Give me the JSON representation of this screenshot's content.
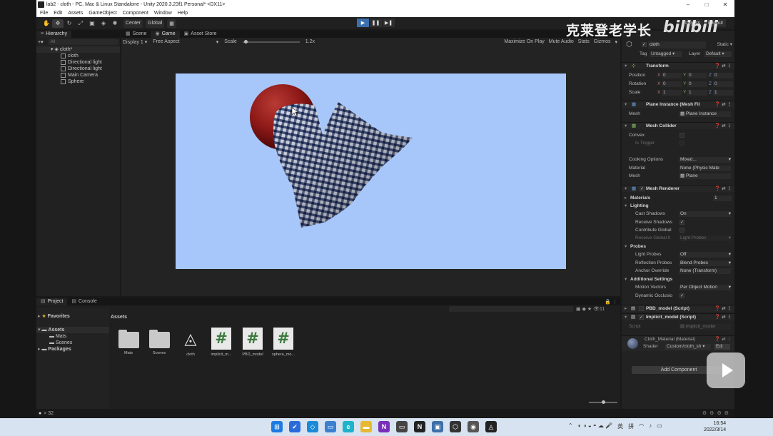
{
  "window": {
    "title": "lab2 - cloth - PC, Mac & Linux Standalone - Unity 2020.3.23f1 Personal* <DX11>",
    "controls": [
      "–",
      "□",
      "✕"
    ]
  },
  "menu": [
    "File",
    "Edit",
    "Assets",
    "GameObject",
    "Component",
    "Window",
    "Help"
  ],
  "toolbar": {
    "pivot": "Center",
    "space": "Global",
    "layers": "Layers",
    "layout": "Layout"
  },
  "watermark": {
    "text": "克莱登老学长",
    "logo": "bilibili"
  },
  "hierarchy": {
    "tab": "Hierarchy",
    "search_placeholder": "All",
    "scene": "cloth*",
    "items": [
      "cloth",
      "Directional light",
      "Directional light",
      "Main Camera",
      "Sphere"
    ]
  },
  "game": {
    "tabs": [
      "Scene",
      "Game",
      "Asset Store"
    ],
    "display": "Display 1",
    "aspect": "Free Aspect",
    "scale_label": "Scale",
    "scale_value": "1.2x",
    "options": [
      "Maximize On Play",
      "Mute Audio",
      "Stats",
      "Gizmos"
    ],
    "viewport_bg": "#a7c7fb",
    "sphere_color": "#8f1a18"
  },
  "inspector": {
    "object_name": "cloth",
    "static": "Static",
    "tag_label": "Tag",
    "tag_value": "Untagged",
    "layer_label": "Layer",
    "layer_value": "Default",
    "transform": {
      "title": "Transform",
      "position_label": "Position",
      "rotation_label": "Rotation",
      "scale_label": "Scale",
      "position": [
        "0",
        "0",
        "0"
      ],
      "rotation": [
        "0",
        "0",
        "0"
      ],
      "scale": [
        "1",
        "1",
        "1"
      ]
    },
    "mesh_filter": {
      "title": "Plane Instance (Mesh Fil",
      "mesh_label": "Mesh",
      "mesh_value": "Plane Instance"
    },
    "mesh_collider": {
      "title": "Mesh Collider",
      "convex": "Convex",
      "is_trigger": "Is Trigger",
      "cooking_label": "Cooking Options",
      "cooking_value": "Mixed...",
      "material_label": "Material",
      "material_value": "None (Physic Mate",
      "mesh_label": "Mesh",
      "mesh_value": "Plane"
    },
    "mesh_renderer": {
      "title": "Mesh Renderer",
      "materials_label": "Materials",
      "materials_count": "1",
      "lighting": "Lighting",
      "cast_shadows_label": "Cast Shadows",
      "cast_shadows_value": "On",
      "receive_shadows": "Receive Shadows",
      "contribute_global": "Contribute Global",
      "receive_gi_label": "Receive Global Il",
      "receive_gi_value": "Light Probes",
      "probes": "Probes",
      "light_probes_label": "Light Probes",
      "light_probes_value": "Off",
      "reflection_label": "Reflection Probes",
      "reflection_value": "Blend Probes",
      "anchor_label": "Anchor Override",
      "anchor_value": "None (Transform)",
      "additional": "Additional Settings",
      "motion_label": "Motion Vectors",
      "motion_value": "Per Object Motion",
      "dynamic_occlusion": "Dynamic Occlusio"
    },
    "scripts": [
      {
        "title": "PBD_model (Script)"
      },
      {
        "title": "Implicit_model (Script)",
        "script_label": "Script",
        "script_value": "implicit_model"
      }
    ],
    "material": {
      "title": "Cloth_Material (Material)",
      "shader_label": "Shader",
      "shader_value": "Custom/cloth_sh",
      "edit": "Edi"
    },
    "add_component": "Add Component"
  },
  "project": {
    "tabs": [
      "Project",
      "Console"
    ],
    "favorites": "Favorites",
    "tree": [
      "Assets",
      "Mats",
      "Scenes",
      "Packages"
    ],
    "breadcrumb": "Assets",
    "count": "11",
    "assets": [
      {
        "label": "Mats",
        "kind": "folder"
      },
      {
        "label": "Scenes",
        "kind": "folder"
      },
      {
        "label": "cloth",
        "kind": "unity"
      },
      {
        "label": "implicit_m...",
        "kind": "script"
      },
      {
        "label": "PBD_model",
        "kind": "script"
      },
      {
        "label": "sphere_mo...",
        "kind": "script"
      }
    ]
  },
  "status": {
    "text": "> 32"
  },
  "taskbar": {
    "ime": "英",
    "ime2": "拼",
    "time": "16:54",
    "date": "2022/3/14"
  }
}
